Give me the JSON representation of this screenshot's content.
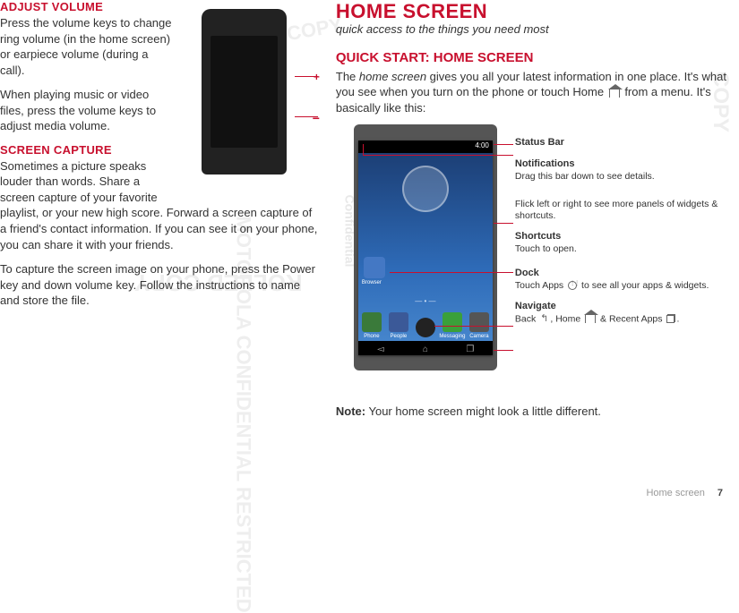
{
  "left": {
    "adjust_volume_heading": "ADJUST VOLUME",
    "adjust_volume_p1": "Press the volume keys to change ring volume (in the home screen) or earpiece volume (during a call).",
    "adjust_volume_p2": "When playing music or video files, press the volume keys to adjust media volume.",
    "screen_capture_heading": "SCREEN CAPTURE",
    "screen_capture_p1": "Sometimes a picture speaks louder than words. Share a screen capture of your favorite playlist, or your new high score. Forward a screen capture of a friend's contact information. If you can see it on your phone, you can share it with your friends.",
    "screen_capture_p2": "To capture the screen image on your phone, press the Power key and down volume key. Follow the instructions to name and store the file."
  },
  "right": {
    "title": "HOME SCREEN",
    "subtitle": "quick access to the things you need most",
    "quick_start_heading": "QUICK START: HOME SCREEN",
    "quick_start_p1a": "The ",
    "quick_start_p1b": "home screen",
    "quick_start_p1c": " gives you all your latest information in one place. It's what you see when you turn on the phone or touch Home ",
    "quick_start_p1d": " from a menu. It's basically like this:",
    "note_label": "Note:",
    "note_text": " Your home screen might look a little different."
  },
  "diagram": {
    "statusbar_time": "4:00",
    "apps": [
      "Phone",
      "People",
      "",
      "Messaging",
      "Camera"
    ],
    "browser_label": "Browser",
    "callouts": {
      "statusbar": {
        "title": "Status Bar"
      },
      "notifications": {
        "title": "Notifications",
        "body": "Drag this bar down to see details."
      },
      "panels": {
        "body": "Flick left or right to see more panels of widgets & shortcuts."
      },
      "shortcuts": {
        "title": "Shortcuts",
        "body": "Touch to open."
      },
      "dock": {
        "title": "Dock",
        "body_a": "Touch Apps ",
        "body_b": " to see all your apps & widgets."
      },
      "navigate": {
        "title": "Navigate",
        "body_a": "Back ",
        "body_b": ", Home ",
        "body_c": " & Recent Apps ",
        "body_d": "."
      }
    }
  },
  "footer": {
    "section": "Home screen",
    "page": "7"
  },
  "watermark": {
    "date": "2012.03.15",
    "fcc": "FCC",
    "conf": "Confidential",
    "copy": "COPY",
    "rolled": "ROLLED COPY",
    "moto": "MOTOROLA CONFIDENTIAL RESTRICTED"
  }
}
